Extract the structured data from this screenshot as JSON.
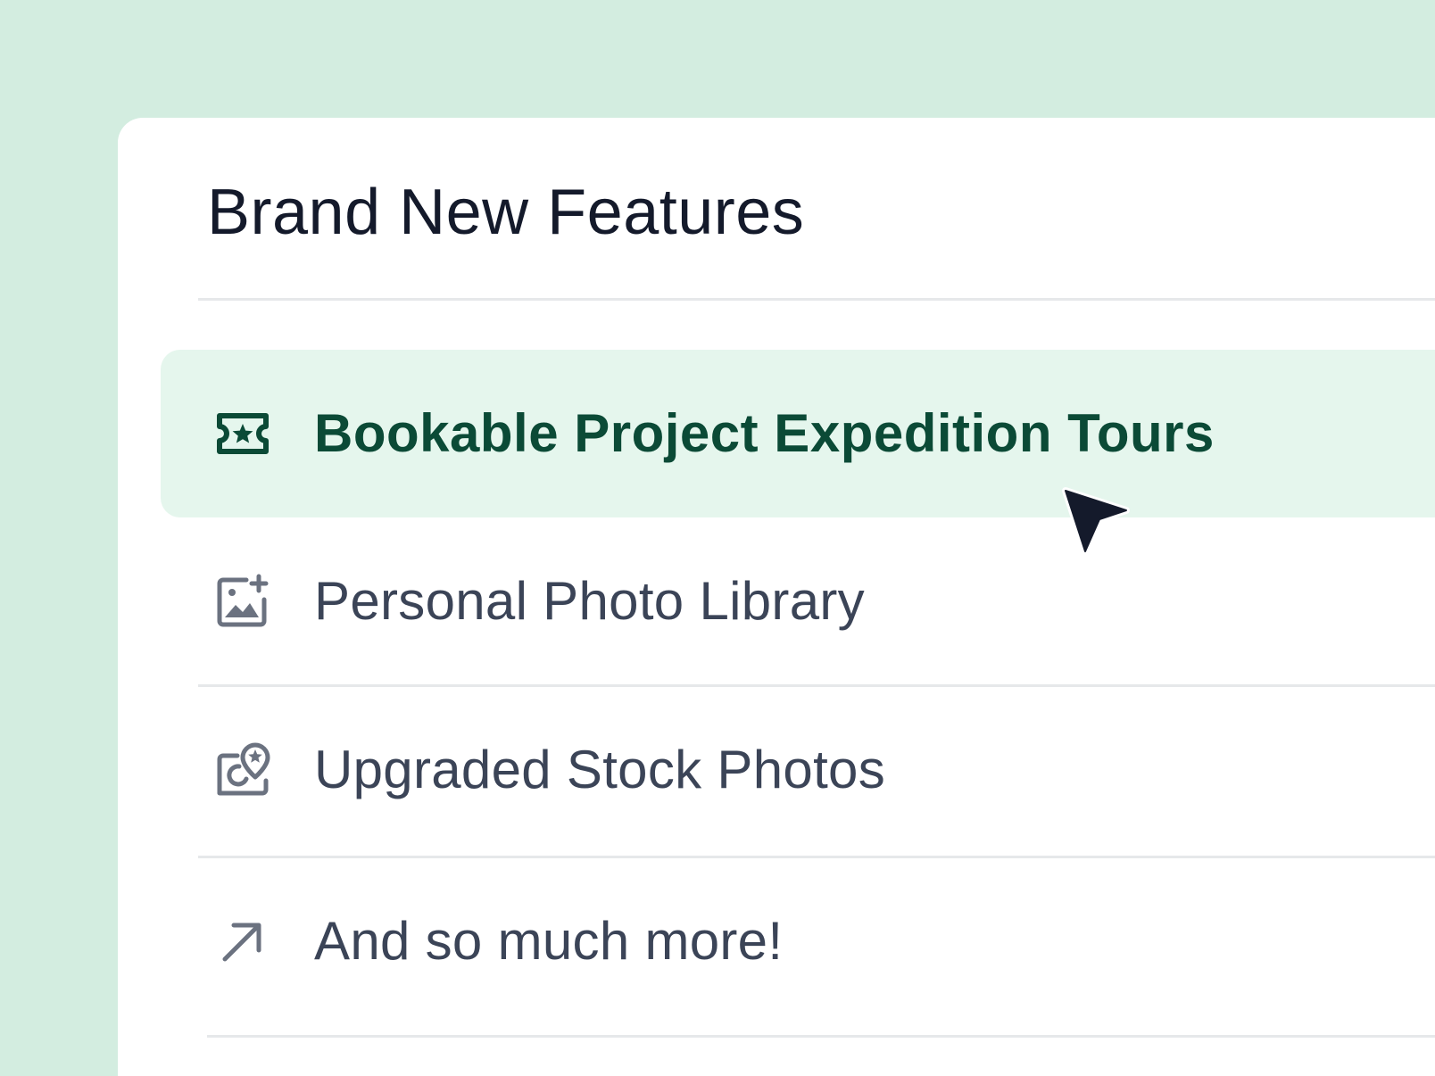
{
  "card": {
    "title": "Brand New Features"
  },
  "features": [
    {
      "label": "Bookable Project Expedition Tours",
      "icon": "ticket-star-icon",
      "active": true
    },
    {
      "label": "Personal Photo Library",
      "icon": "image-add-icon",
      "active": false
    },
    {
      "label": "Upgraded Stock Photos",
      "icon": "photo-location-star-icon",
      "active": false
    },
    {
      "label": "And so much more!",
      "icon": "arrow-up-right-icon",
      "active": false
    }
  ],
  "colors": {
    "page_background": "#d3ede0",
    "card_background": "#ffffff",
    "active_row_background": "#e5f6ed",
    "active_text": "#0b4a36",
    "inactive_text": "#3b4457",
    "title_text": "#141a2b",
    "divider": "#e6e8ea",
    "cursor": "#141a2b"
  }
}
